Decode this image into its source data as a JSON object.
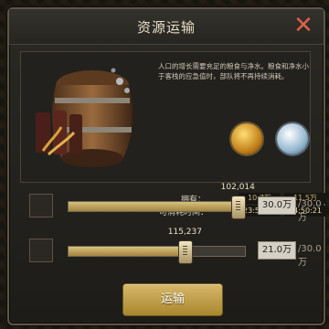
{
  "dialog": {
    "title": "资源运输",
    "close_icon": "close-icon",
    "description": "人口的增长需要充足的粮食与净水。粮食和净水小于客栈的应急值时，部队将不再持续消耗。",
    "labels": {
      "own": "拥有：",
      "consume_time": "可消耗时间："
    },
    "resources": {
      "food": {
        "icon": "wheat-meat-icon",
        "own": "10.7万",
        "time": "23:52:55"
      },
      "water": {
        "icon": "water-drop-icon",
        "own": "11.5万",
        "time": "14:50:21"
      }
    },
    "sliders": {
      "food": {
        "value": "102,014",
        "amount": "30.0万",
        "max": "/30.0万",
        "progress": 0.96
      },
      "water": {
        "value": "115,237",
        "amount": "21.0万",
        "max": "/30.0万",
        "progress": 0.66
      }
    },
    "button_label": "运输",
    "colors": {
      "accent": "#c9a85a",
      "close": "#d9614c"
    }
  }
}
